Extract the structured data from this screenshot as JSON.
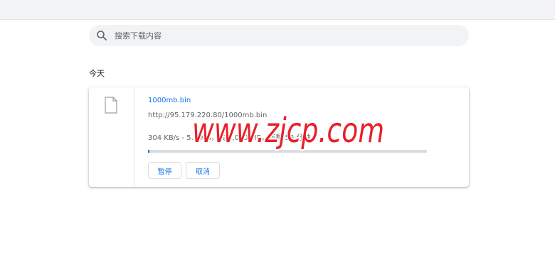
{
  "search": {
    "placeholder": "搜索下载内容",
    "icon": "search-icon"
  },
  "section": {
    "label": "今天"
  },
  "download": {
    "file_name": "1000mb.bin",
    "url": "http://95.179.220.80/1000mb.bin",
    "status": "304 KB/s - 5.8 MB，共 1,000 MB，还剩 56 分钟",
    "progress": 0.0058,
    "icon": "file-icon",
    "pause_label": "暂停",
    "cancel_label": "取消"
  },
  "watermark": {
    "text": "www.zjcp.com",
    "color": "#e8202a"
  },
  "colors": {
    "accent": "#1a73e8",
    "background": "#ffffff",
    "search_bg": "#f1f3f4"
  }
}
